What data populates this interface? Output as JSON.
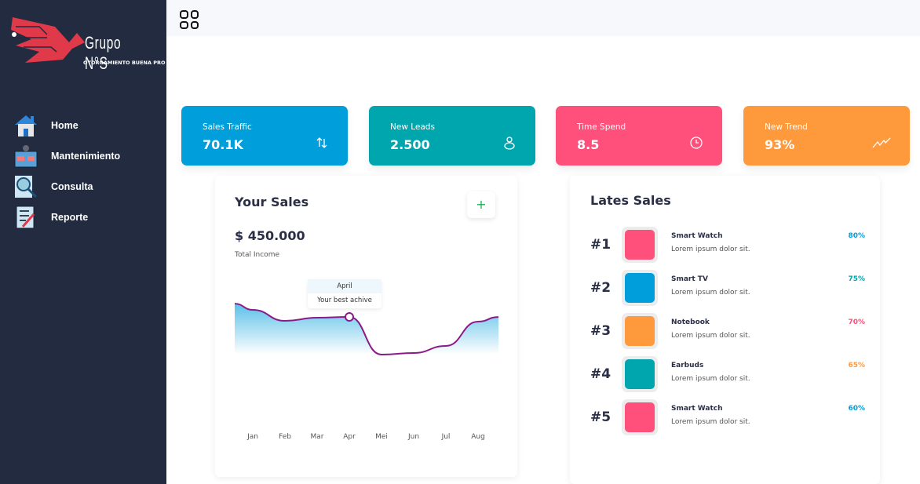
{
  "logo": {
    "brand": "Grupo N°S",
    "tagline": "OTORGAMIENTO BUENA PRO"
  },
  "sidebar": {
    "items": [
      {
        "label": "Home",
        "icon": "home-icon"
      },
      {
        "label": "Mantenimiento",
        "icon": "maintenance-book-icon"
      },
      {
        "label": "Consulta",
        "icon": "search-document-icon"
      },
      {
        "label": "Reporte",
        "icon": "report-checklist-icon"
      }
    ]
  },
  "topbar": {
    "menu_icon": "grid-icon"
  },
  "stats": [
    {
      "label": "Sales Traffic",
      "value": "70.1K",
      "icon": "arrows-up-down-icon",
      "color": "#009fdb"
    },
    {
      "label": "New Leads",
      "value": "2.500",
      "icon": "user-icon",
      "color": "#00a6ad"
    },
    {
      "label": "Time Spend",
      "value": "8.5",
      "icon": "clock-icon",
      "color": "#ff4f7b"
    },
    {
      "label": "New Trend",
      "value": "93%",
      "icon": "trend-icon",
      "color": "#ff9a3c"
    }
  ],
  "sales": {
    "title": "Your Sales",
    "add_label": "+",
    "amount": "$ 450.000",
    "subtitle": "Total Income",
    "tooltip": {
      "title": "April",
      "text": "Your best achive"
    }
  },
  "chart_data": {
    "type": "area",
    "categories": [
      "Jan",
      "Feb",
      "Mar",
      "Apr",
      "Mei",
      "Jun",
      "Jul",
      "Aug"
    ],
    "values": [
      65,
      51,
      55,
      56,
      8,
      10,
      19,
      50
    ],
    "highlight": "Apr",
    "line_color": "#8b1a88",
    "fill_color": "#5bc0e8",
    "grid": false
  },
  "latest": {
    "title": "Lates Sales",
    "items": [
      {
        "rank": "#1",
        "name": "Smart Watch",
        "desc": "Lorem ipsum dolor sit.",
        "percent": "80%",
        "color": "#ff4f7b",
        "pct_color": "#009fdb"
      },
      {
        "rank": "#2",
        "name": "Smart TV",
        "desc": "Lorem ipsum dolor sit.",
        "percent": "75%",
        "color": "#009fdb",
        "pct_color": "#00a6ad"
      },
      {
        "rank": "#3",
        "name": "Notebook",
        "desc": "Lorem ipsum dolor sit.",
        "percent": "70%",
        "color": "#ff9a3c",
        "pct_color": "#ff4f7b"
      },
      {
        "rank": "#4",
        "name": "Earbuds",
        "desc": "Lorem ipsum dolor sit.",
        "percent": "65%",
        "color": "#00a6ad",
        "pct_color": "#ff9a3c"
      },
      {
        "rank": "#5",
        "name": "Smart Watch",
        "desc": "Lorem ipsum dolor sit.",
        "percent": "60%",
        "color": "#ff4f7b",
        "pct_color": "#009fdb"
      }
    ]
  }
}
